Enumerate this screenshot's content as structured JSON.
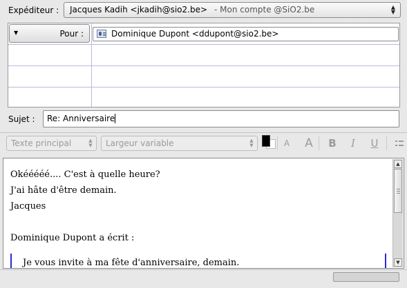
{
  "sender": {
    "label": "Expéditeur :",
    "name": "Jacques Kadih <jkadih@sio2.be>",
    "account": "- Mon compte @SiO2.be"
  },
  "recipients": {
    "type_button": "Pour :",
    "to_value": "Dominique Dupont <ddupont@sio2.be>"
  },
  "subject": {
    "label": "Sujet :",
    "value": "Re: Anniversaire"
  },
  "toolbar": {
    "paragraph_style": "Texte principal",
    "font_width": "Largeur variable",
    "text_color": "#000000",
    "smaller_label": "A",
    "larger_label": "A",
    "bold_label": "B",
    "italic_label": "I",
    "underline_label": "U"
  },
  "body": {
    "lines": [
      "Okééééé.... C'est à quelle heure?",
      "J'ai hâte d'être demain.",
      "Jacques",
      "",
      "Dominique Dupont a écrit :"
    ],
    "quote": "Je vous invite à ma fête d'anniversaire, demain."
  }
}
